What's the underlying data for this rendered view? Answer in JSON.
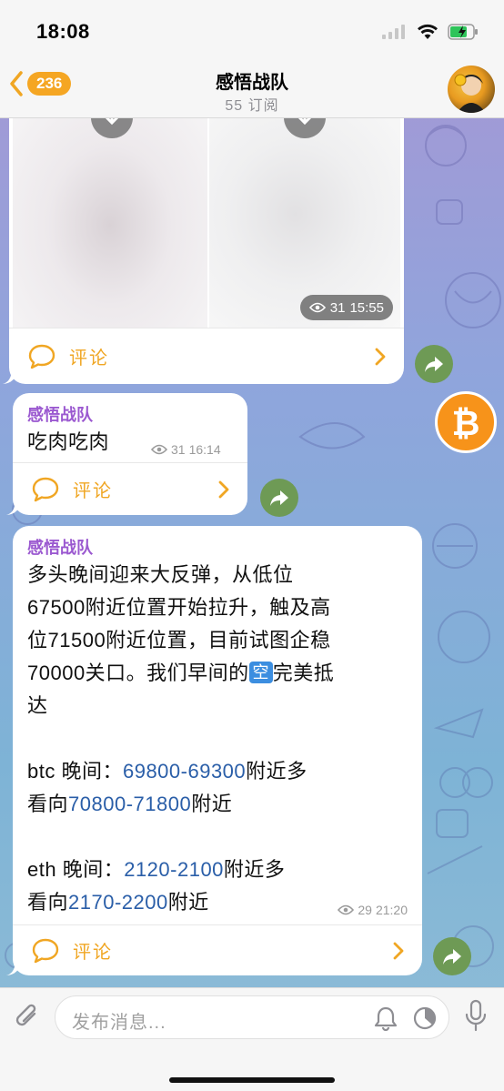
{
  "status": {
    "time": "18:08"
  },
  "nav": {
    "back_count": "236",
    "title": "感悟战队",
    "subtitle": "55 订阅"
  },
  "messages": [
    {
      "id": "photo-post",
      "views": "31",
      "time": "15:55",
      "comment_label": "评论"
    },
    {
      "id": "short-post",
      "channel": "感悟战队",
      "text": "吃肉吃肉",
      "views": "31",
      "time": "16:14",
      "comment_label": "评论"
    },
    {
      "id": "long-post",
      "channel": "感悟战队",
      "p1_line1": "多头晚间迎来大反弹，从低位",
      "p1_line2": "67500附近位置开始拉升，触及高",
      "p1_line3": "位71500附近位置，目前试图企稳",
      "p1_line4a": "70000关口。我们早间的",
      "kong": "空",
      "p1_line4b": "完美抵",
      "p1_line5": "达",
      "btc_prefix": "btc 晚间：",
      "btc_range1": "69800-69300",
      "btc_mid": "附近多",
      "btc_line2_prefix": "看向",
      "btc_range2": "70800-71800",
      "btc_suffix": "附近",
      "eth_prefix": "eth 晚间：",
      "eth_range1": "2120-2100",
      "eth_mid": "附近多",
      "eth_line2_prefix": "看向",
      "eth_range2": "2170-2200",
      "eth_suffix": "附近",
      "views": "29",
      "time": "21:20",
      "comment_label": "评论"
    }
  ],
  "input": {
    "placeholder": "发布消息..."
  },
  "colors": {
    "accent": "#f0a623",
    "channel_name": "#9b59d0",
    "link": "#2a5ea8",
    "share": "#6e9a55",
    "bitcoin": "#f7931a"
  },
  "icons": [
    "back-chevron-icon",
    "wifi-icon",
    "battery-icon",
    "signal-icon",
    "download-icon",
    "eye-icon",
    "comment-icon",
    "chevron-right-icon",
    "share-icon",
    "bitcoin-icon",
    "attach-icon",
    "bell-icon",
    "timer-icon",
    "mic-icon"
  ]
}
